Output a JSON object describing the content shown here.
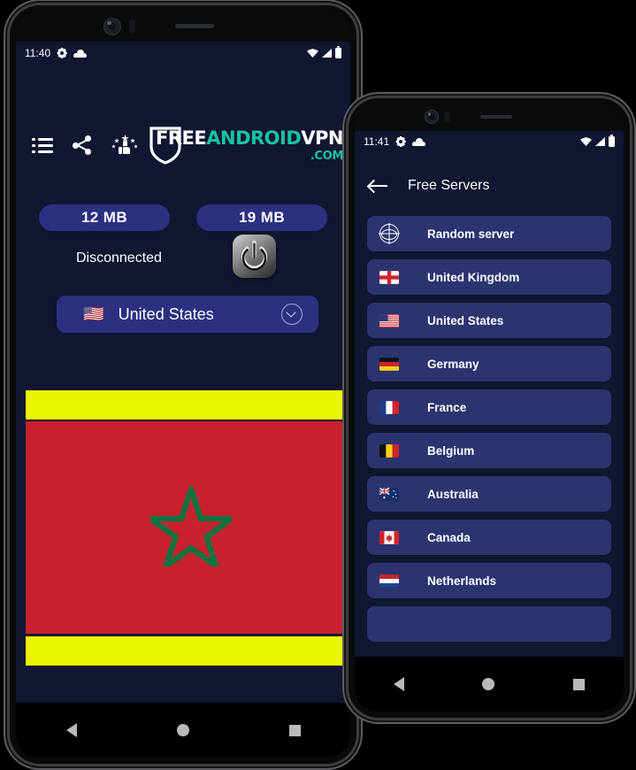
{
  "colors": {
    "screen_bg": "#111631",
    "card_blue": "#2c3470",
    "pill_blue": "#2b3080",
    "logo_teal": "#17c2a4",
    "logo_white": "#ffffff",
    "banner_yellow": "#e9f500",
    "banner_red": "#c8222e",
    "banner_green": "#11713f",
    "accent_orange": "#ef6a43"
  },
  "phone1": {
    "status_bar": {
      "time": "11:40",
      "left_icons": [
        "gear-icon",
        "cloud-icon"
      ],
      "right_icons": [
        "wifi-icon",
        "signal-icon",
        "battery-icon"
      ]
    },
    "toolbar": {
      "icons": [
        "list-icon",
        "share-icon",
        "rate-icon"
      ],
      "logo": {
        "part1": "FREE",
        "part2": "ANDROID",
        "part3": "VPN",
        "part4": ".COM"
      }
    },
    "stats": {
      "download": "12 MB",
      "upload": "19 MB"
    },
    "connection_status": "Disconnected",
    "power_button": "power-icon",
    "server_select": {
      "flag": "🇺🇸",
      "name": "United States",
      "chevron": "chevron-down-icon"
    },
    "banner": {
      "type": "morocco-flag-ad"
    },
    "nav": [
      "back",
      "home",
      "recents"
    ]
  },
  "phone2": {
    "status_bar": {
      "time": "11:41",
      "left_icons": [
        "gear-icon",
        "cloud-icon"
      ],
      "right_icons": [
        "wifi-icon",
        "signal-icon",
        "battery-icon"
      ]
    },
    "appbar": {
      "back": "arrow-left-icon",
      "title": "Free Servers"
    },
    "servers": [
      {
        "icon": "globe-icon",
        "flag": "",
        "label": "Random server"
      },
      {
        "icon": "flag",
        "flag": "gb-eng",
        "label": "United Kingdom"
      },
      {
        "icon": "flag",
        "flag": "us",
        "label": "United States"
      },
      {
        "icon": "flag",
        "flag": "de",
        "label": "Germany"
      },
      {
        "icon": "flag",
        "flag": "fr",
        "label": "France"
      },
      {
        "icon": "flag",
        "flag": "be",
        "label": "Belgium"
      },
      {
        "icon": "flag",
        "flag": "au",
        "label": "Australia"
      },
      {
        "icon": "flag",
        "flag": "ca",
        "label": "Canada"
      },
      {
        "icon": "flag",
        "flag": "nl",
        "label": "Netherlands"
      },
      {
        "icon": "flag",
        "flag": "",
        "label": ""
      }
    ],
    "nav": [
      "back",
      "home",
      "recents"
    ]
  }
}
